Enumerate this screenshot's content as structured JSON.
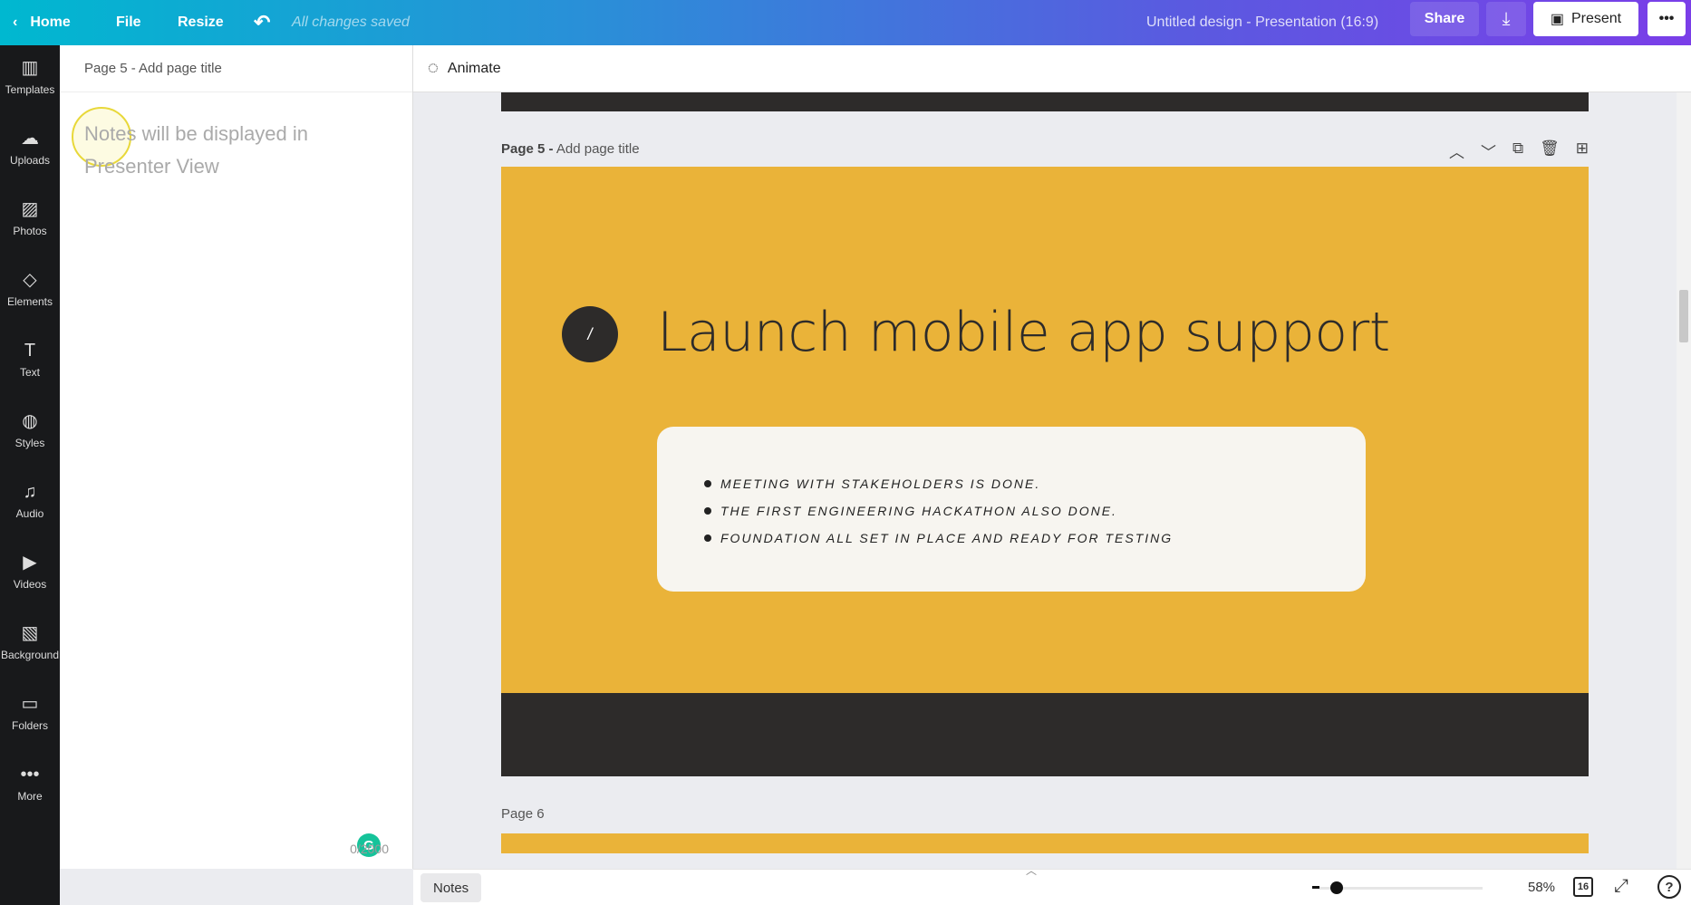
{
  "topbar": {
    "home": "Home",
    "file": "File",
    "resize": "Resize",
    "saved": "All changes saved",
    "title": "Untitled design - Presentation (16:9)",
    "share": "Share",
    "present": "Present",
    "more": "•••"
  },
  "sidebar": {
    "items": [
      {
        "label": "Templates",
        "icon": "▥"
      },
      {
        "label": "Uploads",
        "icon": "☁"
      },
      {
        "label": "Photos",
        "icon": "▨"
      },
      {
        "label": "Elements",
        "icon": "◇"
      },
      {
        "label": "Text",
        "icon": "T"
      },
      {
        "label": "Styles",
        "icon": "◍"
      },
      {
        "label": "Audio",
        "icon": "♫"
      },
      {
        "label": "Videos",
        "icon": "▶"
      },
      {
        "label": "Background",
        "icon": "▧"
      },
      {
        "label": "Folders",
        "icon": "▭"
      },
      {
        "label": "More",
        "icon": "•••"
      }
    ]
  },
  "notes": {
    "header": "Page 5 - Add page title",
    "placeholder": "Notes will be displayed in Presenter View",
    "count": "0/2000",
    "grammarly": "G"
  },
  "animate": "Animate",
  "page5": {
    "prefix": "Page 5 -",
    "title_placeholder": "Add page title",
    "number_mark": "/",
    "title": "Launch mobile app support",
    "bullets": [
      "Meeting with stakeholders is done.",
      "The first engineering hackathon also done.",
      "Foundation all set in place and ready for testing"
    ]
  },
  "page6": {
    "label": "Page 6"
  },
  "bottombar": {
    "notes": "Notes",
    "zoom": "58%",
    "zoom_level": 58,
    "page_count": "16",
    "help": "?"
  },
  "colors": {
    "slide_bg": "#eab339",
    "dark": "#2d2b2a",
    "box": "#f7f5f0"
  }
}
